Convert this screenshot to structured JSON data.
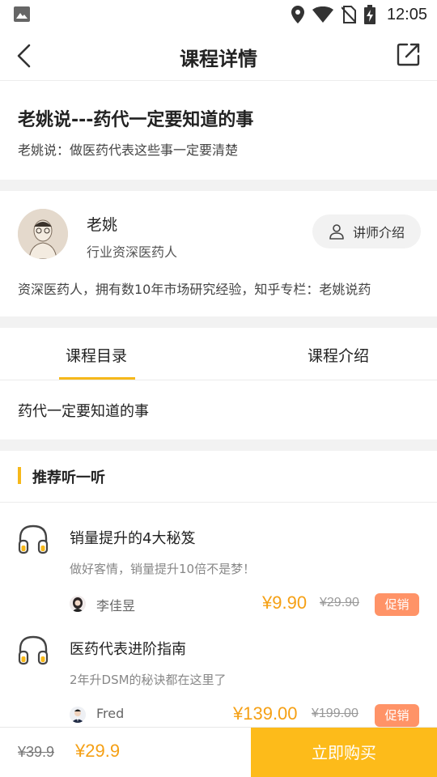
{
  "status_bar": {
    "time": "12:05",
    "icons": [
      "image-icon",
      "location-icon",
      "wifi-icon",
      "no-sim-icon",
      "battery-charging-icon"
    ]
  },
  "nav": {
    "title": "课程详情",
    "back_icon": "chevron-left-icon",
    "share_icon": "share-icon"
  },
  "course": {
    "title": "老姚说---药代一定要知道的事",
    "subtitle": "老姚说：做医药代表这些事一定要清楚"
  },
  "teacher": {
    "name": "老姚",
    "role": "行业资深医药人",
    "intro_button": "讲师介绍",
    "description": "资深医药人，拥有数10年市场研究经验，知乎专栏：老姚说药"
  },
  "tabs": [
    {
      "label": "课程目录",
      "active": true
    },
    {
      "label": "课程介绍",
      "active": false
    }
  ],
  "catalog": {
    "items": [
      "药代一定要知道的事"
    ]
  },
  "recommend": {
    "section_title": "推荐听一听",
    "items": [
      {
        "title": "销量提升的4大秘笈",
        "subtitle": "做好客情，销量提升10倍不是梦！",
        "author": "李佳昱",
        "price": "¥9.90",
        "original_price": "¥29.90",
        "badge": "促销"
      },
      {
        "title": "医药代表进阶指南",
        "subtitle": "2年升DSM的秘诀都在这里了",
        "author": "Fred",
        "price": "¥139.00",
        "original_price": "¥199.00",
        "badge": "促销"
      }
    ]
  },
  "footer": {
    "original_price": "¥39.9",
    "price": "¥29.9",
    "buy_label": "立即购买"
  },
  "colors": {
    "accent": "#f6b81a",
    "price": "#f5a015",
    "badge": "#ff9367",
    "buy_button": "#fdbb1a"
  }
}
